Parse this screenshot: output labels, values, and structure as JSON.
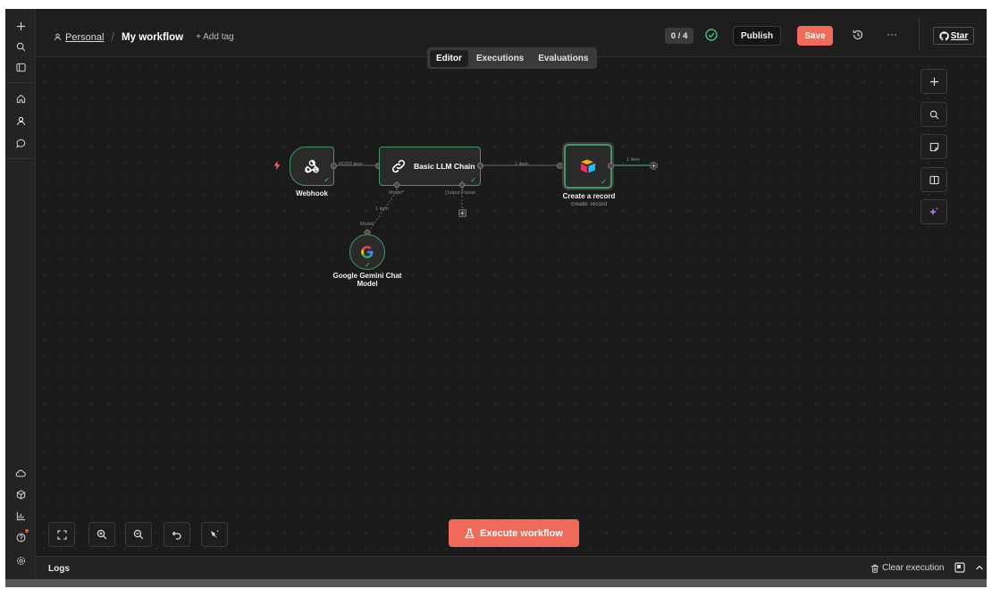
{
  "header": {
    "project": "Personal",
    "separator": "/",
    "workflow_name": "My workflow",
    "add_tag": "+ Add tag",
    "counter": "0 / 4",
    "publish_label": "Publish",
    "save_label": "Save",
    "more_label": "···",
    "star_label": "Star"
  },
  "tabs": [
    {
      "label": "Editor",
      "active": true
    },
    {
      "label": "Executions",
      "active": false
    },
    {
      "label": "Evaluations",
      "active": false
    }
  ],
  "rail": {
    "top_icons": [
      "plus-icon",
      "search-icon",
      "sidebar-toggle-icon"
    ],
    "nav_icons": [
      "home-icon",
      "user-icon",
      "chat-icon"
    ],
    "bottom_icons": [
      "cloud-icon",
      "templates-icon",
      "insights-icon",
      "help-icon",
      "settings-icon"
    ]
  },
  "right_tools": [
    "plus-icon",
    "search-icon",
    "sticky-note-icon",
    "panel-icon",
    "ai-sparkle-icon"
  ],
  "nodes": {
    "webhook": {
      "label": "Webhook",
      "out_label": "POST item"
    },
    "llm_chain": {
      "label": "Basic LLM Chain",
      "model_label": "Model*",
      "parser_label": "Output Parser",
      "out_label": "1 item"
    },
    "create_record": {
      "label": "Create a record",
      "sub": "create: record",
      "out_label": "1 item"
    },
    "gemini": {
      "label_line1": "Google Gemini Chat",
      "label_line2": "Model",
      "in_label": "Model",
      "link_label": "1 item"
    }
  },
  "footer": {
    "execute_label": "Execute workflow",
    "logs_label": "Logs",
    "clear_label": "Clear execution"
  },
  "colors": {
    "accent": "#f06a5a",
    "success": "#4ac17a",
    "canvas": "#1b1b1b"
  }
}
